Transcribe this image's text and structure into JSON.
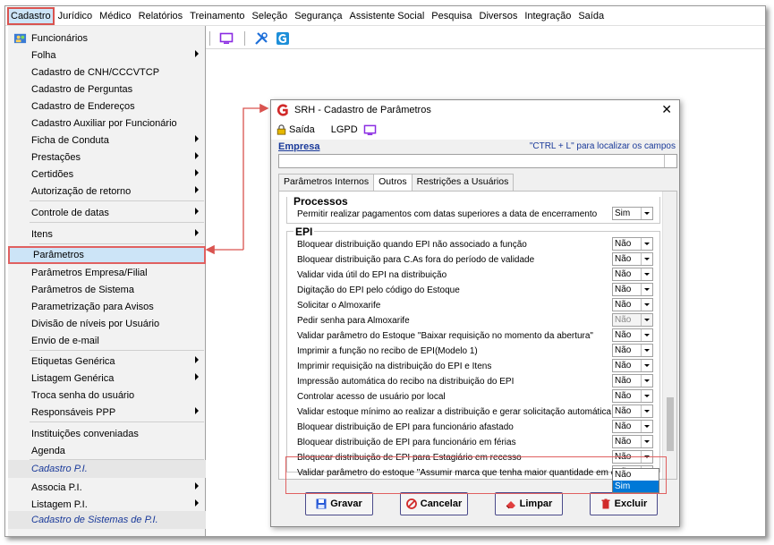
{
  "menubar": [
    "Cadastro",
    "Jurídico",
    "Médico",
    "Relatórios",
    "Treinamento",
    "Seleção",
    "Segurança",
    "Assistente Social",
    "Pesquisa",
    "Diversos",
    "Integração",
    "Saída"
  ],
  "dropdown": {
    "items": [
      "Funcionários",
      "Folha",
      "Cadastro de CNH/CCCVTCP",
      "Cadastro de Perguntas",
      "Cadastro de Endereços",
      "Cadastro Auxiliar por Funcionário",
      "Ficha de Conduta",
      "Prestações",
      "Certidões",
      "Autorização de retorno",
      "Controle de datas",
      "Itens",
      "Parâmetros",
      "Parâmetros Empresa/Filial",
      "Parâmetros de Sistema",
      "Parametrização para Avisos",
      "Divisão de níveis por Usuário",
      "Envio de e-mail",
      "Etiquetas Genérica",
      "Listagem Genérica",
      "Troca senha do usuário",
      "Responsáveis PPP",
      "Instituições conveniadas",
      "Agenda",
      "Cadastro P.I.",
      "Associa P.I.",
      "Listagem P.I.",
      "Cadastro de Sistemas de P.I."
    ]
  },
  "dialog": {
    "title": "SRH - Cadastro de Parâmetros",
    "saida": "Saída",
    "lgpd": "LGPD",
    "empresa_label": "Empresa",
    "hint": "\"CTRL + L\" para localizar os campos",
    "tabs": [
      "Parâmetros Internos",
      "Outros",
      "Restrições a Usuários"
    ],
    "processos_title": "Processos",
    "processos_rows": [
      {
        "label": "Permitir realizar pagamentos com datas superiores a data de encerramento",
        "value": "Sim"
      }
    ],
    "epi_title": "EPI",
    "epi_rows": [
      {
        "label": "Bloquear distribuição quando EPI não associado a função",
        "value": "Não"
      },
      {
        "label": "Bloquear distribuição para C.As fora do período de validade",
        "value": "Não"
      },
      {
        "label": "Validar vida útil do EPI na distribuição",
        "value": "Não"
      },
      {
        "label": "Digitação do EPI pelo código do Estoque",
        "value": "Não"
      },
      {
        "label": "Solicitar o Almoxarife",
        "value": "Não"
      },
      {
        "label": "Pedir senha para Almoxarife",
        "value": "Não"
      },
      {
        "label": "Validar parâmetro do Estoque \"Baixar requisição no momento da abertura\"",
        "value": "Não"
      },
      {
        "label": "Imprimir a função no recibo de EPI(Modelo 1)",
        "value": "Não"
      },
      {
        "label": "Imprimir requisição na distribuição do EPI e Itens",
        "value": "Não"
      },
      {
        "label": "Impressão automática do recibo na distribuição do EPI",
        "value": "Não"
      },
      {
        "label": "Controlar acesso de usuário por local",
        "value": "Não"
      },
      {
        "label": "Validar estoque mínimo ao realizar a distribuição e gerar solicitação automática",
        "value": "Não"
      },
      {
        "label": "Bloquear distribuição de EPI para funcionário afastado",
        "value": "Não"
      },
      {
        "label": "Bloquear distribuição de EPI para funcionário em férias",
        "value": "Não"
      },
      {
        "label": "Bloquear distribuição de EPI para Estagiário em recesso",
        "value": "Não"
      },
      {
        "label": "Validar parâmetro do estoque \"Assumir marca que tenha maior quantidade em estoque\"",
        "value": "Não"
      }
    ],
    "options": [
      "Não",
      "Sim"
    ],
    "buttons": {
      "gravar": "Gravar",
      "cancelar": "Cancelar",
      "limpar": "Limpar",
      "excluir": "Excluir"
    }
  },
  "colors": {
    "accent": "#1a3a9a",
    "highlight": "#e06060",
    "selected_bg": "#cce4f7"
  }
}
